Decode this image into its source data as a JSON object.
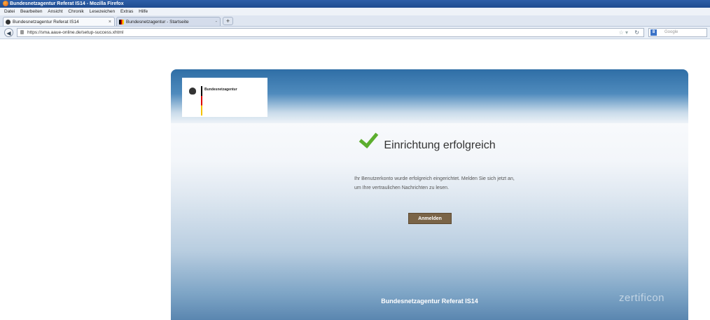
{
  "window": {
    "title": "Bundesnetzagentur Referat IS14 - Mozilla Firefox"
  },
  "menu": [
    "Datei",
    "Bearbeiten",
    "Ansicht",
    "Chronik",
    "Lesezeichen",
    "Extras",
    "Hilfe"
  ],
  "tabs": [
    {
      "label": "Bundesnetzagentur Referat IS14"
    },
    {
      "label": "Bundesnetzagentur - Startseite"
    }
  ],
  "nav": {
    "url": "https://sma.aaue-online.de/setup-success.xhtml",
    "search_placeholder": "Google",
    "search_engine": "8"
  },
  "page": {
    "logo_text": "Bundesnetzagentur",
    "heading": "Einrichtung erfolgreich",
    "message": "Ihr Benutzerkonto wurde erfolgreich eingerichtet. Melden Sie sich jetzt an, um Ihre vertraulichen Nachrichten zu lesen.",
    "button": "Anmelden",
    "footer": "Bundesnetzagentur Referat IS14",
    "watermark": "zertificon"
  }
}
